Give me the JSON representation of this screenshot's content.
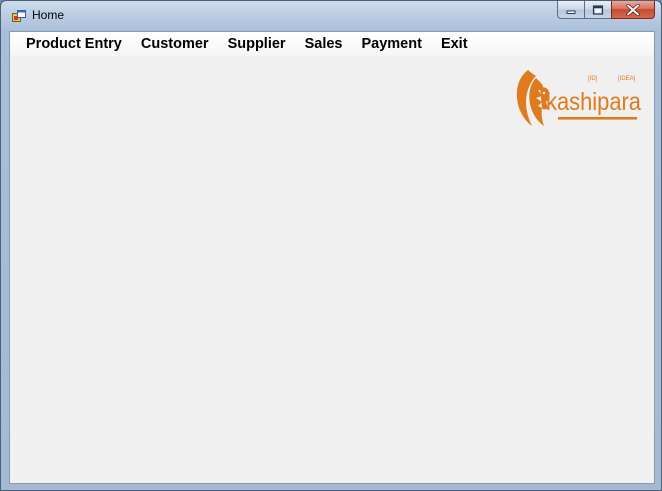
{
  "window": {
    "title": "Home",
    "app_icon": "windows-forms-app-icon",
    "caption_buttons": {
      "minimize_icon": "minimize-icon",
      "maximize_icon": "maximize-icon",
      "close_icon": "close-icon"
    }
  },
  "menu": {
    "items": [
      {
        "label": "Product Entry"
      },
      {
        "label": "Customer"
      },
      {
        "label": "Supplier"
      },
      {
        "label": "Sales"
      },
      {
        "label": "Payment"
      },
      {
        "label": "Exit"
      }
    ]
  },
  "logo": {
    "text": "kashipara",
    "icon": "lion-head-logo",
    "accent_color": "#e07a1f"
  }
}
